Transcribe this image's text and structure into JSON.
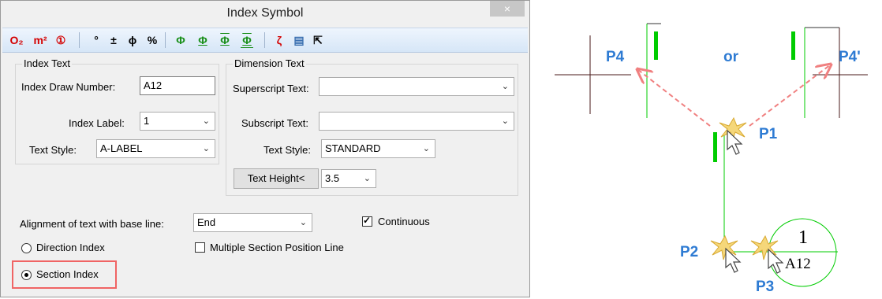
{
  "dialog": {
    "title": "Index Symbol",
    "close_glyph": "×",
    "toolbar": [
      {
        "name": "o2-subscript-icon",
        "glyph": "O₂",
        "color": "red"
      },
      {
        "name": "m2-superscript-icon",
        "glyph": "m²",
        "color": "red"
      },
      {
        "name": "circled-one-icon",
        "glyph": "①",
        "color": "red"
      },
      {
        "name": "degree-icon",
        "glyph": "°",
        "color": "blk"
      },
      {
        "name": "plus-minus-icon",
        "glyph": "±",
        "color": "blk"
      },
      {
        "name": "diameter-icon",
        "glyph": "ϕ",
        "color": "blk"
      },
      {
        "name": "percent-icon",
        "glyph": "%",
        "color": "blk"
      },
      {
        "name": "steel-grade-1-icon",
        "glyph": "Φ",
        "color": "grn"
      },
      {
        "name": "steel-grade-2-icon",
        "glyph": "Φ",
        "color": "grn"
      },
      {
        "name": "steel-grade-3-icon",
        "glyph": "Φ",
        "color": "grn"
      },
      {
        "name": "steel-grade-4-icon",
        "glyph": "Φ",
        "color": "grn"
      },
      {
        "name": "special-char-icon",
        "glyph": "ζ",
        "color": "red"
      },
      {
        "name": "symbol-library-icon",
        "glyph": "▤",
        "color": "blk"
      },
      {
        "name": "pick-text-icon",
        "glyph": "⇱",
        "color": "blk"
      }
    ],
    "index_text": {
      "group_label": "Index Text",
      "draw_number_label": "Index Draw Number:",
      "draw_number_value": "A12",
      "index_label_label": "Index Label:",
      "index_label_value": "1",
      "text_style_label": "Text Style:",
      "text_style_value": "A-LABEL"
    },
    "dimension_text": {
      "group_label": "Dimension Text",
      "superscript_label": "Superscript Text:",
      "superscript_value": "",
      "subscript_label": "Subscript Text:",
      "subscript_value": "",
      "text_style_label": "Text Style:",
      "text_style_value": "STANDARD",
      "text_height_button": "Text Height<",
      "text_height_value": "3.5"
    },
    "alignment_label": "Alignment of text with base line:",
    "alignment_value": "End",
    "continuous_label": "Continuous",
    "continuous_checked": true,
    "direction_index_label": "Direction Index",
    "multiple_section_label": "Multiple Section Position Line",
    "multiple_section_checked": false,
    "section_index_label": "Section Index",
    "selected_index_type": "section"
  },
  "drawing": {
    "labels": {
      "p1": "P1",
      "p2": "P2",
      "p3": "P3",
      "p4": "P4",
      "p4_prime": "P4'",
      "or": "or"
    },
    "symbol_number": "1",
    "symbol_draw_number": "A12"
  },
  "colors": {
    "accent": "#2e7bd3",
    "line_green": "#00cc00",
    "arrow": "#f08080",
    "highlight": "#f06464"
  }
}
